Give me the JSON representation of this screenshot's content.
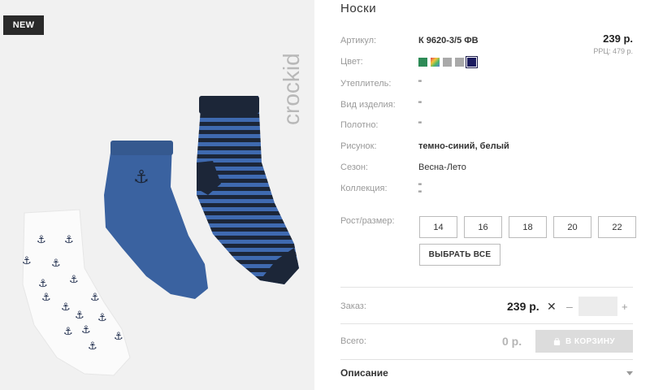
{
  "badge": "NEW",
  "product": {
    "title": "Носки",
    "price": "239 р.",
    "rrp": "РРЦ: 479 р."
  },
  "attributes": [
    {
      "label": "Артикул:",
      "value": "К 9620-3/5 ФВ",
      "bold": true
    },
    {
      "label": "Цвет:",
      "value": ""
    },
    {
      "label": "Утеплитель:",
      "value": "\""
    },
    {
      "label": "Вид изделия:",
      "value": "\""
    },
    {
      "label": "Полотно:",
      "value": "\""
    },
    {
      "label": "Рисунок:",
      "value": "темно-синий, белый",
      "bold": true
    },
    {
      "label": "Сезон:",
      "value": "Весна-Лето"
    },
    {
      "label": "Коллекция:",
      "value": "\"\n\""
    }
  ],
  "colors": [
    "#2e8b57",
    "rainbow",
    "#a9a9a9",
    "#a9a9a9",
    "#1a1a5e"
  ],
  "size_label": "Рост/размер:",
  "sizes": [
    "14",
    "16",
    "18",
    "20",
    "22"
  ],
  "select_all": "ВЫБРАТЬ ВСЕ",
  "order": {
    "label": "Заказ:",
    "price": "239 р.",
    "times": "✕",
    "minus": "–",
    "plus": "+"
  },
  "total": {
    "label": "Всего:",
    "value": "0 р.",
    "cart_button": "В КОРЗИНУ"
  },
  "description": "Описание",
  "brand": "crockid"
}
